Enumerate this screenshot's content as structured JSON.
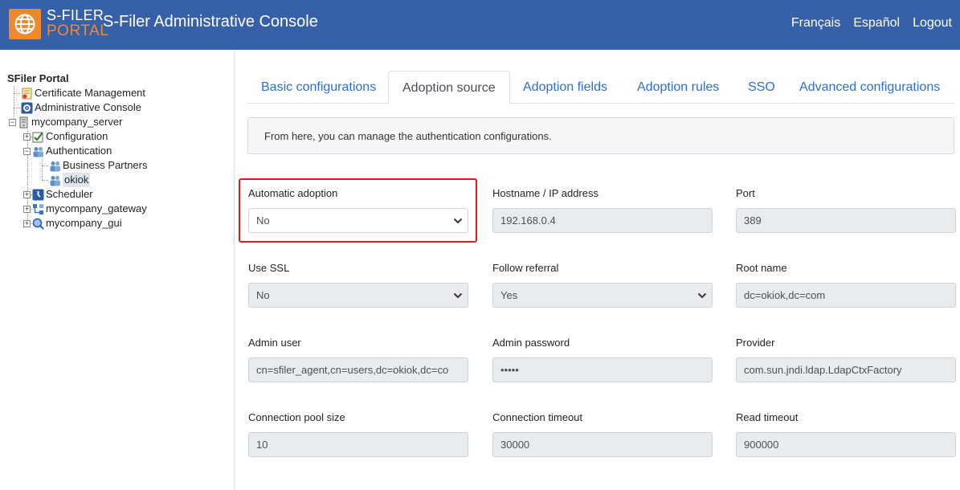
{
  "header": {
    "logo_line1": "S-FILER",
    "logo_line2": "PORTAL",
    "title": "S-Filer Administrative Console",
    "nav": [
      "Français",
      "Español",
      "Logout"
    ]
  },
  "tree": {
    "root": "SFiler Portal",
    "items": {
      "cert": "Certificate Management",
      "admin": "Administrative Console",
      "server": "mycompany_server",
      "config": "Configuration",
      "auth": "Authentication",
      "partners": "Business Partners",
      "okiok": "okiok",
      "scheduler": "Scheduler",
      "gateway": "mycompany_gateway",
      "gui": "mycompany_gui"
    }
  },
  "tabs": [
    "Basic configurations",
    "Adoption source",
    "Adoption fields",
    "Adoption rules",
    "SSO",
    "Advanced configurations"
  ],
  "active_tab": "Adoption source",
  "info": "From here, you can manage the authentication configurations.",
  "fields": {
    "auto_adoption": {
      "label": "Automatic adoption",
      "value": "No"
    },
    "hostname": {
      "label": "Hostname / IP address",
      "value": "192.168.0.4"
    },
    "port": {
      "label": "Port",
      "value": "389"
    },
    "use_ssl": {
      "label": "Use SSL",
      "value": "No"
    },
    "follow_referral": {
      "label": "Follow referral",
      "value": "Yes"
    },
    "root_name": {
      "label": "Root name",
      "value": "dc=okiok,dc=com"
    },
    "admin_user": {
      "label": "Admin user",
      "value": "cn=sfiler_agent,cn=users,dc=okiok,dc=co"
    },
    "admin_password": {
      "label": "Admin password",
      "value": "•••••"
    },
    "provider": {
      "label": "Provider",
      "value": "com.sun.jndi.ldap.LdapCtxFactory"
    },
    "pool_size": {
      "label": "Connection pool size",
      "value": "10"
    },
    "conn_timeout": {
      "label": "Connection timeout",
      "value": "30000"
    },
    "read_timeout": {
      "label": "Read timeout",
      "value": "900000"
    }
  },
  "colors": {
    "header_bg": "#3661a9",
    "logo_orange": "#f0892e",
    "tab_link": "#2f6fd0",
    "highlight": "#e8151a"
  }
}
